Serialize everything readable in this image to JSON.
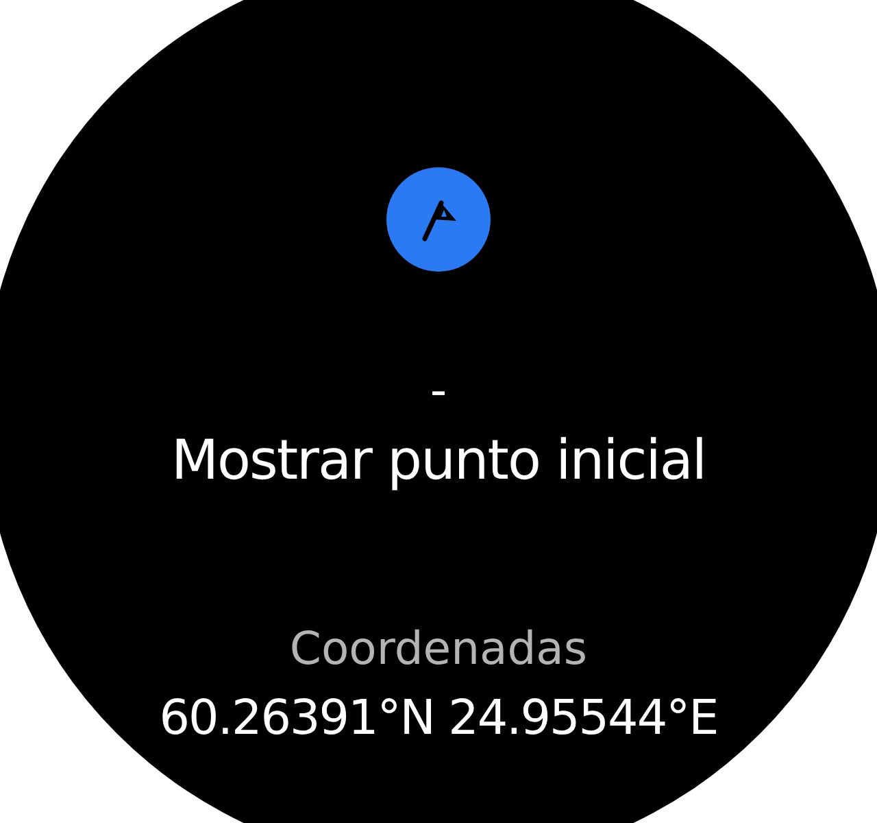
{
  "value": "-",
  "title": "Mostrar punto inicial",
  "coordinates": {
    "label": "Coordenadas",
    "value": "60.26391°N 24.95544°E"
  }
}
